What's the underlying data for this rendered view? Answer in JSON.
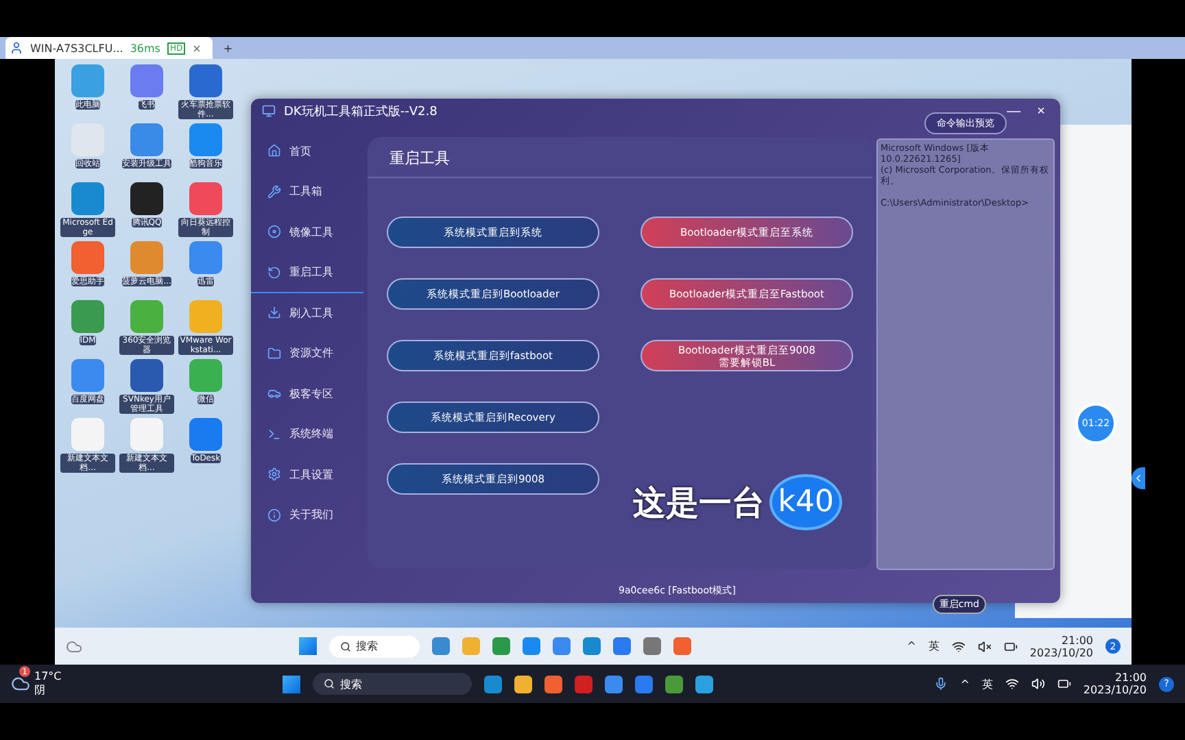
{
  "browser_tab": {
    "title": "WIN-A7S3CLFU...",
    "ping": "36ms",
    "quality": "HD",
    "close": "×",
    "new_tab": "+"
  },
  "desktop_icons": [
    {
      "label": "此电脑",
      "color": "#3aa0e0"
    },
    {
      "label": "飞书",
      "color": "#6a7cf0"
    },
    {
      "label": "火车票抢票软件...",
      "color": "#2a6ad0"
    },
    {
      "label": "回收站",
      "color": "#dfe6ee"
    },
    {
      "label": "安装升级工具",
      "color": "#3a8ae8"
    },
    {
      "label": "酷狗音乐",
      "color": "#1a8af0"
    },
    {
      "label": "Microsoft Edge",
      "color": "#1a8ad0"
    },
    {
      "label": "腾讯QQ",
      "color": "#222222"
    },
    {
      "label": "向日葵远程控制",
      "color": "#f04a5a"
    },
    {
      "label": "爱思助手",
      "color": "#f06030"
    },
    {
      "label": "菠萝云电脑...",
      "color": "#e08a30"
    },
    {
      "label": "迅雷",
      "color": "#3a8af0"
    },
    {
      "label": "IDM",
      "color": "#3a9a50"
    },
    {
      "label": "360安全浏览器",
      "color": "#4ab040"
    },
    {
      "label": "VMware Workstati...",
      "color": "#f0b020"
    },
    {
      "label": "百度网盘",
      "color": "#3a8af0"
    },
    {
      "label": "SVNkey用户管理工具",
      "color": "#2a5ab0"
    },
    {
      "label": "微信",
      "color": "#3ab050"
    },
    {
      "label": "新建文本文档...",
      "color": "#f4f4f4"
    },
    {
      "label": "新建文本文档...",
      "color": "#f4f4f4"
    },
    {
      "label": "ToDesk",
      "color": "#1a7af0"
    }
  ],
  "app": {
    "title": "DK玩机工具箱正式版--V2.8",
    "minimize": "—",
    "close": "×",
    "sidebar": [
      {
        "label": "首页",
        "selected": false
      },
      {
        "label": "工具箱",
        "selected": false
      },
      {
        "label": "镜像工具",
        "selected": false
      },
      {
        "label": "重启工具",
        "selected": true
      },
      {
        "label": "刷入工具",
        "selected": false
      },
      {
        "label": "资源文件",
        "selected": false
      },
      {
        "label": "极客专区",
        "selected": false
      },
      {
        "label": "系统终端",
        "selected": false
      },
      {
        "label": "工具设置",
        "selected": false
      },
      {
        "label": "关于我们",
        "selected": false
      }
    ],
    "panel_title": "重启工具",
    "system_buttons": [
      "系统模式重启到系统",
      "系统模式重启到Bootloader",
      "系统模式重启到fastboot",
      "系统模式重启到Recovery",
      "系统模式重启到9008"
    ],
    "bootloader_buttons": [
      [
        "Bootloader模式重启至系统"
      ],
      [
        "Bootloader模式重启至Fastboot"
      ],
      [
        "Bootloader模式重启至9008",
        "需要解锁BL"
      ]
    ],
    "caption": {
      "text": "这是一台",
      "highlight": "k40"
    },
    "output_button": "命令输出预览",
    "console": [
      [
        "Microsoft Windows [版本 10.0.22621.1265]",
        "(c) Microsoft Corporation。保留所有权利。"
      ],
      [
        "C:\\Users\\Administrator\\Desktop>"
      ]
    ],
    "device_status": "9a0cee6c [Fastboot模式]",
    "restart_cmd": "重启cmd"
  },
  "timer": "01:22",
  "remote_taskbar": {
    "search": "搜索",
    "tray": [
      "^",
      "英"
    ],
    "time": "21:00",
    "date": "2023/10/20",
    "badge": "2"
  },
  "local_taskbar": {
    "weather_badge": "1",
    "temperature": "17°C",
    "weather": "阴",
    "search": "搜索",
    "tray": [
      "^",
      "英"
    ],
    "time": "21:00",
    "date": "2023/10/20",
    "badge": "?"
  }
}
